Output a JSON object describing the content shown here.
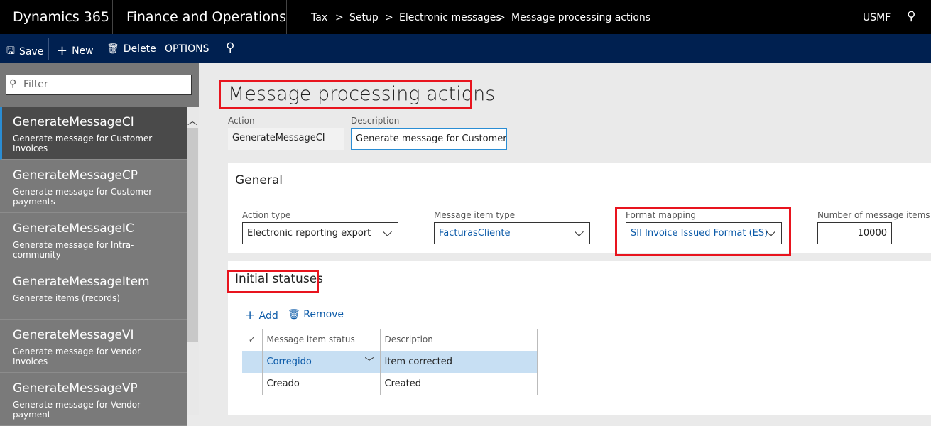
{
  "header": {
    "app": "Dynamics 365",
    "module": "Finance and Operations",
    "breadcrumb": [
      "Tax",
      "Setup",
      "Electronic messages",
      "Message processing actions"
    ],
    "company": "USMF"
  },
  "toolbar": {
    "save": "Save",
    "new": "New",
    "delete": "Delete",
    "options": "OPTIONS"
  },
  "sidebar": {
    "filter_placeholder": "Filter",
    "items": [
      {
        "title": "GenerateMessageCI",
        "subtitle": "Generate message for Customer Invoices",
        "selected": true
      },
      {
        "title": "GenerateMessageCP",
        "subtitle": "Generate message for Customer payments"
      },
      {
        "title": "GenerateMessageIC",
        "subtitle": "Generate message for Intra-community"
      },
      {
        "title": "GenerateMessageItem",
        "subtitle": "Generate items (records)"
      },
      {
        "title": "GenerateMessageVI",
        "subtitle": "Generate message for Vendor Invoices"
      },
      {
        "title": "GenerateMessageVP",
        "subtitle": "Generate message for Vendor payment"
      }
    ]
  },
  "main": {
    "title": "Message processing actions",
    "action_label": "Action",
    "action_value": "GenerateMessageCI",
    "description_label": "Description",
    "description_value": "Generate message for Customer Invoices",
    "general": {
      "title": "General",
      "action_type_label": "Action type",
      "action_type": "Electronic reporting export",
      "item_type_label": "Message item type",
      "item_type": "FacturasCliente",
      "format_label": "Format mapping",
      "format": "SII Invoice Issued Format (ES)",
      "number_label": "Number of message items per",
      "number": "10000"
    },
    "statuses": {
      "title": "Initial statuses",
      "add": "Add",
      "remove": "Remove",
      "columns": [
        "Message item status",
        "Description"
      ],
      "rows": [
        [
          "Corregido",
          "Item corrected"
        ],
        [
          "Creado",
          "Created"
        ]
      ]
    }
  },
  "colors": {
    "highlight": "#e8141e",
    "accent": "#0b5aa8",
    "nav": "#002050"
  }
}
